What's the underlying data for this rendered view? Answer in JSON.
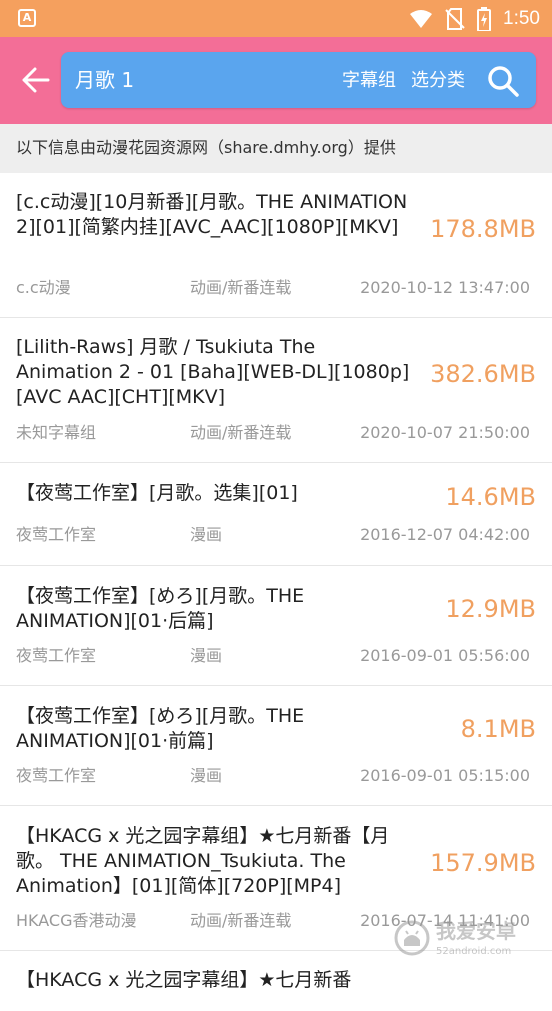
{
  "status_bar": {
    "app_badge": "A",
    "time": "1:50",
    "icons": [
      "wifi-icon",
      "no-sim-icon",
      "battery-charging-icon"
    ]
  },
  "toolbar": {
    "back_icon": "arrow-left-icon",
    "search": {
      "value": "月歌 1",
      "group_label": "字幕组",
      "category_label": "选分类",
      "search_icon": "search-icon"
    }
  },
  "info_text": "以下信息由动漫花园资源网（share.dmhy.org）提供",
  "items": [
    {
      "title": "[c.c动漫][10月新番][月歌。THE ANIMATION 2][01][简繁内挂][AVC_AAC][1080P][MKV]",
      "size": "178.8MB",
      "team": "c.c动漫",
      "category": "动画/新番连载",
      "date": "2020-10-12 13:47:00"
    },
    {
      "title": "[Lilith-Raws] 月歌 / Tsukiuta The Animation 2 - 01 [Baha][WEB-DL][1080p][AVC AAC][CHT][MKV]",
      "size": "382.6MB",
      "team": "未知字幕组",
      "category": "动画/新番连载",
      "date": "2020-10-07 21:50:00"
    },
    {
      "title": "【夜莺工作室】[月歌。选集][01]",
      "size": "14.6MB",
      "team": "夜莺工作室",
      "category": "漫画",
      "date": "2016-12-07 04:42:00"
    },
    {
      "title": "【夜莺工作室】[めろ][月歌。THE ANIMATION][01·后篇]",
      "size": "12.9MB",
      "team": "夜莺工作室",
      "category": "漫画",
      "date": "2016-09-01 05:56:00"
    },
    {
      "title": "【夜莺工作室】[めろ][月歌。THE ANIMATION][01·前篇]",
      "size": "8.1MB",
      "team": "夜莺工作室",
      "category": "漫画",
      "date": "2016-09-01 05:15:00"
    },
    {
      "title": "【HKACG x 光之园字幕组】★七月新番【月歌。 THE ANIMATION_Tsukiuta. The Animation】[01][简体][720P][MP4]",
      "size": "157.9MB",
      "team": "HKACG香港动漫",
      "category": "动画/新番连载",
      "date": "2016-07-14 11:41:00"
    },
    {
      "title": "【HKACG x 光之园字幕组】★七月新番",
      "size": "",
      "team": "",
      "category": "",
      "date": ""
    }
  ],
  "watermark": {
    "text": "我爱安卓",
    "url": "52android.com"
  },
  "colors": {
    "status_bar": "#f5a05e",
    "toolbar": "#f36e97",
    "search_box": "#5aa5ee",
    "size_text": "#f0a060",
    "meta_text": "#999999"
  }
}
